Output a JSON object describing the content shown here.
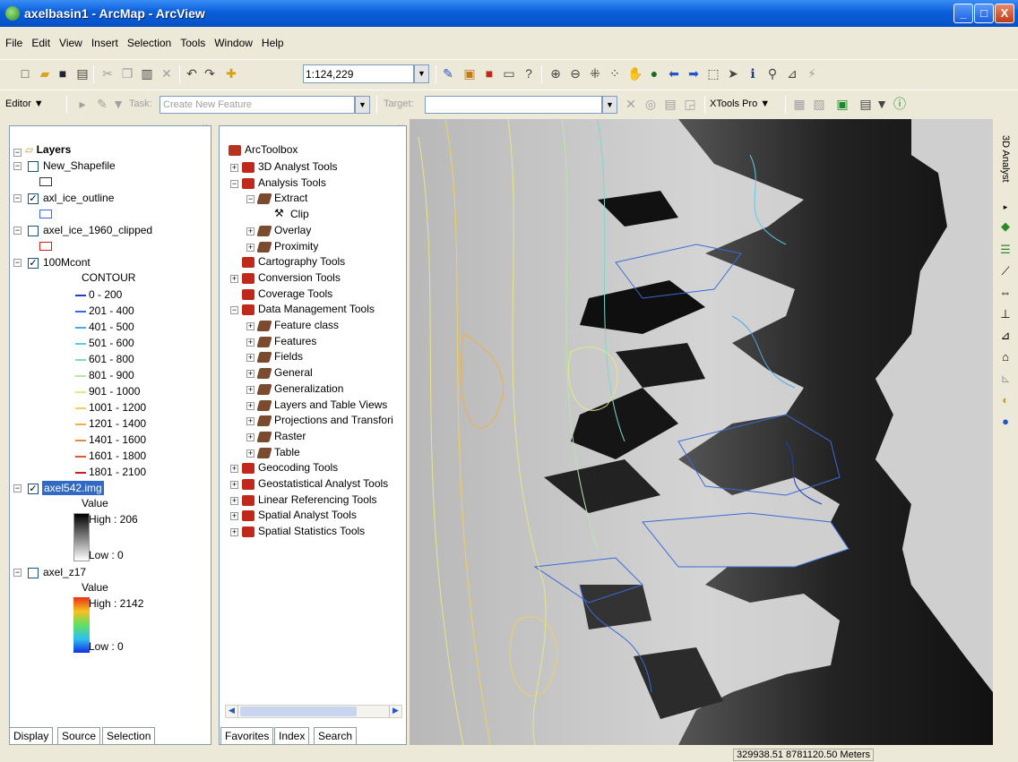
{
  "window": {
    "title": "axelbasin1 - ArcMap - ArcView",
    "min": "_",
    "max": "□",
    "close": "X"
  },
  "menu": [
    "File",
    "Edit",
    "View",
    "Insert",
    "Selection",
    "Tools",
    "Window",
    "Help"
  ],
  "standard_toolbar": {
    "scale": "1:124,229"
  },
  "editor_toolbar": {
    "editor_label": "Editor ▼",
    "task_label": "Task:",
    "task_value": "Create New Feature",
    "target_label": "Target:",
    "target_value": "",
    "xtools_label": "XTools Pro ▼"
  },
  "toc": {
    "root": "Layers",
    "layers": [
      {
        "name": "New_Shapefile",
        "checked": false
      },
      {
        "name": "axl_ice_outline",
        "checked": true
      },
      {
        "name": "axel_ice_1960_clipped",
        "checked": false
      },
      {
        "name": "100Mcont",
        "checked": true,
        "field": "CONTOUR"
      },
      {
        "name": "axel542.img",
        "checked": true,
        "value_label": "Value",
        "high": "High : 206",
        "low": "Low : 0"
      },
      {
        "name": "axel_z17",
        "checked": false,
        "value_label": "Value",
        "high": "High : 2142",
        "low": "Low : 0"
      }
    ],
    "contour_classes": [
      {
        "label": "0 - 200",
        "color": "#1f3fbf"
      },
      {
        "label": "201 - 400",
        "color": "#3a6bd8"
      },
      {
        "label": "401 - 500",
        "color": "#4fa6e6"
      },
      {
        "label": "501 - 600",
        "color": "#5fc8e8"
      },
      {
        "label": "601 - 800",
        "color": "#7fd8c8"
      },
      {
        "label": "801 - 900",
        "color": "#b8e6a8"
      },
      {
        "label": "901 - 1000",
        "color": "#e6e68c"
      },
      {
        "label": "1001 - 1200",
        "color": "#f0d060"
      },
      {
        "label": "1201 - 1400",
        "color": "#f0b040"
      },
      {
        "label": "1401 - 1600",
        "color": "#e88a3a"
      },
      {
        "label": "1601 - 1800",
        "color": "#e05a30"
      },
      {
        "label": "1801 - 2100",
        "color": "#c81e1e"
      }
    ],
    "tabs": [
      "Display",
      "Source",
      "Selection"
    ]
  },
  "toolbox": {
    "root": "ArcToolbox",
    "items": [
      {
        "label": "3D Analyst Tools",
        "level": 0,
        "kind": "toolbox",
        "exp": "+"
      },
      {
        "label": "Analysis Tools",
        "level": 0,
        "kind": "toolbox",
        "exp": "−"
      },
      {
        "label": "Extract",
        "level": 1,
        "kind": "toolset",
        "exp": "−"
      },
      {
        "label": "Clip",
        "level": 2,
        "kind": "tool",
        "exp": ""
      },
      {
        "label": "Overlay",
        "level": 1,
        "kind": "toolset",
        "exp": "+"
      },
      {
        "label": "Proximity",
        "level": 1,
        "kind": "toolset",
        "exp": "+"
      },
      {
        "label": "Cartography Tools",
        "level": 0,
        "kind": "toolbox",
        "exp": ""
      },
      {
        "label": "Conversion Tools",
        "level": 0,
        "kind": "toolbox",
        "exp": "+"
      },
      {
        "label": "Coverage Tools",
        "level": 0,
        "kind": "toolbox",
        "exp": ""
      },
      {
        "label": "Data Management Tools",
        "level": 0,
        "kind": "toolbox",
        "exp": "−"
      },
      {
        "label": "Feature class",
        "level": 1,
        "kind": "toolset",
        "exp": "+"
      },
      {
        "label": "Features",
        "level": 1,
        "kind": "toolset",
        "exp": "+"
      },
      {
        "label": "Fields",
        "level": 1,
        "kind": "toolset",
        "exp": "+"
      },
      {
        "label": "General",
        "level": 1,
        "kind": "toolset",
        "exp": "+"
      },
      {
        "label": "Generalization",
        "level": 1,
        "kind": "toolset",
        "exp": "+"
      },
      {
        "label": "Layers and Table Views",
        "level": 1,
        "kind": "toolset",
        "exp": "+"
      },
      {
        "label": "Projections and Transfori",
        "level": 1,
        "kind": "toolset",
        "exp": "+"
      },
      {
        "label": "Raster",
        "level": 1,
        "kind": "toolset",
        "exp": "+"
      },
      {
        "label": "Table",
        "level": 1,
        "kind": "toolset",
        "exp": "+"
      },
      {
        "label": "Geocoding Tools",
        "level": 0,
        "kind": "toolbox",
        "exp": "+"
      },
      {
        "label": "Geostatistical Analyst Tools",
        "level": 0,
        "kind": "toolbox",
        "exp": "+"
      },
      {
        "label": "Linear Referencing Tools",
        "level": 0,
        "kind": "toolbox",
        "exp": "+"
      },
      {
        "label": "Spatial Analyst Tools",
        "level": 0,
        "kind": "toolbox",
        "exp": "+"
      },
      {
        "label": "Spatial Statistics Tools",
        "level": 0,
        "kind": "toolbox",
        "exp": "+"
      }
    ],
    "tabs": [
      "Favorites",
      "Index",
      "Search"
    ]
  },
  "right_toolbar": {
    "label": "3D Analyst"
  },
  "status": {
    "coords": "329938.51  8781120.50 Meters"
  }
}
